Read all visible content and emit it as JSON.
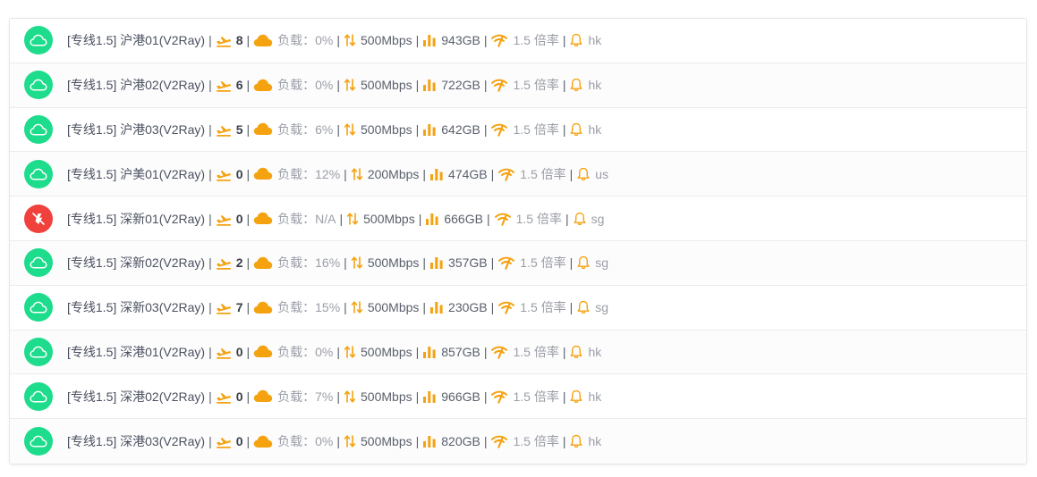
{
  "colors": {
    "online": "#1ddc8c",
    "offline": "#f0413c",
    "accent": "#f5a210"
  },
  "load_label": "负载：",
  "rate_label": "1.5 倍率",
  "servers": [
    {
      "name": "[专线1.5] 沪港01(V2Ray)",
      "status": "online",
      "status_icon": "cloud-icon",
      "users": "8",
      "load": "0%",
      "bandwidth": "500Mbps",
      "traffic": "943GB",
      "region": "hk"
    },
    {
      "name": "[专线1.5] 沪港02(V2Ray)",
      "status": "online",
      "status_icon": "cloud-icon",
      "users": "6",
      "load": "0%",
      "bandwidth": "500Mbps",
      "traffic": "722GB",
      "region": "hk"
    },
    {
      "name": "[专线1.5] 沪港03(V2Ray)",
      "status": "online",
      "status_icon": "cloud-icon",
      "users": "5",
      "load": "6%",
      "bandwidth": "500Mbps",
      "traffic": "642GB",
      "region": "hk"
    },
    {
      "name": "[专线1.5] 沪美01(V2Ray)",
      "status": "online",
      "status_icon": "cloud-icon",
      "users": "0",
      "load": "12%",
      "bandwidth": "200Mbps",
      "traffic": "474GB",
      "region": "us"
    },
    {
      "name": "[专线1.5] 深新01(V2Ray)",
      "status": "offline",
      "status_icon": "no-signal-icon",
      "users": "0",
      "load": "N/A",
      "bandwidth": "500Mbps",
      "traffic": "666GB",
      "region": "sg"
    },
    {
      "name": "[专线1.5] 深新02(V2Ray)",
      "status": "online",
      "status_icon": "cloud-icon",
      "users": "2",
      "load": "16%",
      "bandwidth": "500Mbps",
      "traffic": "357GB",
      "region": "sg"
    },
    {
      "name": "[专线1.5] 深新03(V2Ray)",
      "status": "online",
      "status_icon": "cloud-icon",
      "users": "7",
      "load": "15%",
      "bandwidth": "500Mbps",
      "traffic": "230GB",
      "region": "sg"
    },
    {
      "name": "[专线1.5] 深港01(V2Ray)",
      "status": "online",
      "status_icon": "cloud-icon",
      "users": "0",
      "load": "0%",
      "bandwidth": "500Mbps",
      "traffic": "857GB",
      "region": "hk"
    },
    {
      "name": "[专线1.5] 深港02(V2Ray)",
      "status": "online",
      "status_icon": "cloud-icon",
      "users": "0",
      "load": "7%",
      "bandwidth": "500Mbps",
      "traffic": "966GB",
      "region": "hk"
    },
    {
      "name": "[专线1.5] 深港03(V2Ray)",
      "status": "online",
      "status_icon": "cloud-icon",
      "users": "0",
      "load": "0%",
      "bandwidth": "500Mbps",
      "traffic": "820GB",
      "region": "hk"
    }
  ]
}
